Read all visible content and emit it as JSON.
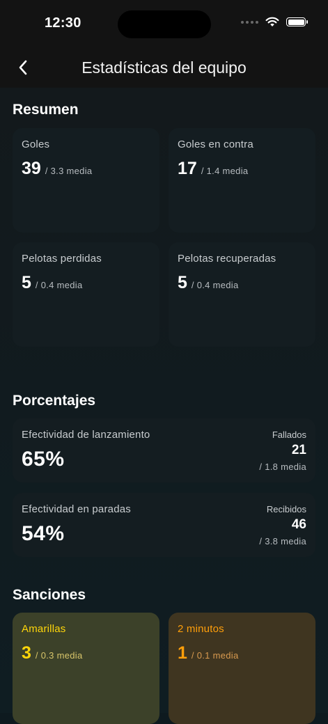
{
  "status": {
    "time": "12:30"
  },
  "nav": {
    "title": "Estadísticas del equipo",
    "back_icon": "chevron-left-icon"
  },
  "resumen": {
    "title": "Resumen",
    "cards": [
      {
        "label": "Goles",
        "value": "39",
        "avg": "/ 3.3 media"
      },
      {
        "label": "Goles en contra",
        "value": "17",
        "avg": "/ 1.4 media"
      },
      {
        "label": "Pelotas perdidas",
        "value": "5",
        "avg": "/ 0.4 media"
      },
      {
        "label": "Pelotas recuperadas",
        "value": "5",
        "avg": "/ 0.4 media"
      }
    ]
  },
  "porcentajes": {
    "title": "Porcentajes",
    "cards": [
      {
        "label": "Efectividad de lanzamiento",
        "value": "65%",
        "side_label": "Fallados",
        "side_value": "21",
        "side_avg": "/ 1.8 media"
      },
      {
        "label": "Efectividad en paradas",
        "value": "54%",
        "side_label": "Recibidos",
        "side_value": "46",
        "side_avg": "/ 3.8 media"
      }
    ]
  },
  "sanciones": {
    "title": "Sanciones",
    "cards": [
      {
        "label": "Amarillas",
        "value": "3",
        "avg": "/ 0.3 media",
        "color": "#ffd60a"
      },
      {
        "label": "2 minutos",
        "value": "1",
        "avg": "/ 0.1 media",
        "color": "#ff9f0a"
      }
    ]
  }
}
